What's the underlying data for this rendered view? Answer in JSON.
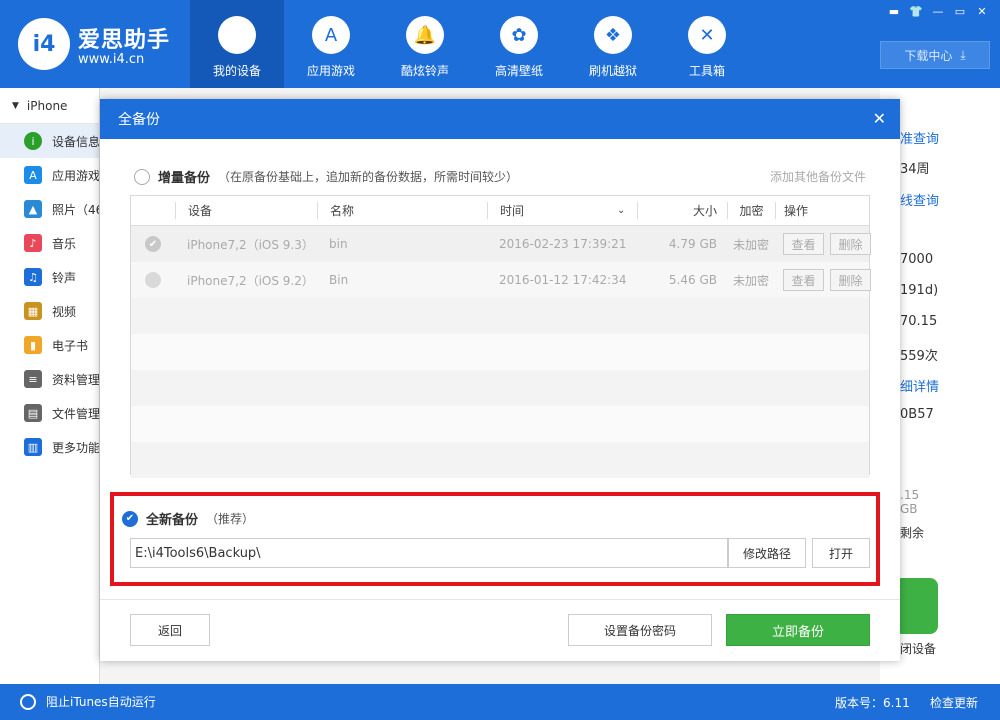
{
  "brand": {
    "logo_text": "i4",
    "name": "爱思助手",
    "url": "www.i4.cn"
  },
  "nav": [
    {
      "label": "我的设备",
      "icon": "apple-icon",
      "glyph": ""
    },
    {
      "label": "应用游戏",
      "icon": "app-store-icon",
      "glyph": "A"
    },
    {
      "label": "酷炫铃声",
      "icon": "bell-icon",
      "glyph": "🔔"
    },
    {
      "label": "高清壁纸",
      "icon": "flower-icon",
      "glyph": "✿"
    },
    {
      "label": "刷机越狱",
      "icon": "dropbox-icon",
      "glyph": "❖"
    },
    {
      "label": "工具箱",
      "icon": "tools-icon",
      "glyph": "✕"
    }
  ],
  "window_controls": [
    "▬",
    "👕",
    "—",
    "▭",
    "✕"
  ],
  "download_center": {
    "label": "下载中心",
    "icon_glyph": "⤓"
  },
  "sidebar": {
    "device": "iPhone",
    "items": [
      {
        "label": "设备信息",
        "icon": "info-icon",
        "glyph": "i",
        "color": "#2aa02a"
      },
      {
        "label": "应用游戏",
        "icon": "app-store-icon",
        "glyph": "A",
        "color": "#1d8be8"
      },
      {
        "label": "照片（46",
        "icon": "photo-icon",
        "glyph": "▲",
        "color": "#2b8ad6"
      },
      {
        "label": "音乐",
        "icon": "music-icon",
        "glyph": "♪",
        "color": "#e8495a"
      },
      {
        "label": "铃声",
        "icon": "bell-icon",
        "glyph": "♫",
        "color": "#1d6ed8"
      },
      {
        "label": "视频",
        "icon": "video-icon",
        "glyph": "▦",
        "color": "#c9931d"
      },
      {
        "label": "电子书",
        "icon": "book-icon",
        "glyph": "▮",
        "color": "#f0a627"
      },
      {
        "label": "资料管理",
        "icon": "contacts-icon",
        "glyph": "≡",
        "color": "#666"
      },
      {
        "label": "文件管理",
        "icon": "file-icon",
        "glyph": "▤",
        "color": "#666"
      },
      {
        "label": "更多功能",
        "icon": "more-icon",
        "glyph": "▥",
        "color": "#1d6ed8"
      }
    ]
  },
  "right_panel": {
    "rows": [
      "准查询",
      "34周",
      "线查询",
      "7000",
      "191d)",
      "70.15",
      "559次",
      "细详情",
      "0B57",
      ".15 GB",
      "剩余",
      "闭设备"
    ]
  },
  "dialog": {
    "title": "全备份",
    "close_glyph": "✕",
    "incremental": {
      "label": "增量备份",
      "desc": "（在原备份基础上，追加新的备份数据，所需时间较少）",
      "add_other": "添加其他备份文件"
    },
    "table": {
      "headers": {
        "device": "设备",
        "name": "名称",
        "time": "时间",
        "size": "大小",
        "encrypt": "加密",
        "ops": "操作"
      },
      "rows": [
        {
          "device": "iPhone7,2（iOS 9.3）",
          "name": "bin",
          "time": "2016-02-23 17:39:21",
          "size": "4.79 GB",
          "encrypt": "未加密",
          "view": "查看",
          "delete": "删除",
          "checked": true
        },
        {
          "device": "iPhone7,2（iOS 9.2）",
          "name": "Bin",
          "time": "2016-01-12 17:42:34",
          "size": "5.46 GB",
          "encrypt": "未加密",
          "view": "查看",
          "delete": "删除",
          "checked": false
        }
      ]
    },
    "full": {
      "label": "全新备份",
      "tag": "（推荐）",
      "path": "E:\\i4Tools6\\Backup\\",
      "change_path": "修改路径",
      "open": "打开"
    },
    "buttons": {
      "back": "返回",
      "set_password": "设置备份密码",
      "start": "立即备份"
    }
  },
  "bottombar": {
    "itunes_toggle": "阻止iTunes自动运行",
    "version": "版本号：6.11",
    "check_update": "检查更新"
  }
}
